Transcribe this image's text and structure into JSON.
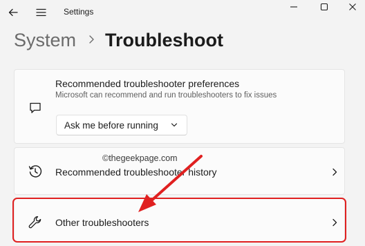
{
  "window": {
    "title": "Settings",
    "icons": {
      "back": "back-arrow-icon",
      "menu": "hamburger-menu-icon",
      "minimize": "minimize-icon",
      "maximize": "maximize-icon",
      "close": "close-icon"
    }
  },
  "breadcrumb": {
    "parent": "System",
    "separator": ">",
    "current": "Troubleshoot"
  },
  "cards": {
    "preferences": {
      "title": "Recommended troubleshooter preferences",
      "description": "Microsoft can recommend and run troubleshooters to fix issues",
      "dropdown_value": "Ask me before running",
      "icon": "chat-message-icon"
    },
    "history": {
      "title": "Recommended troubleshooter history",
      "icon": "history-icon"
    },
    "other": {
      "title": "Other troubleshooters",
      "icon": "wrench-icon"
    }
  },
  "watermark": "©thegeekpage.com",
  "annotation": {
    "highlight_color": "#e02020"
  }
}
